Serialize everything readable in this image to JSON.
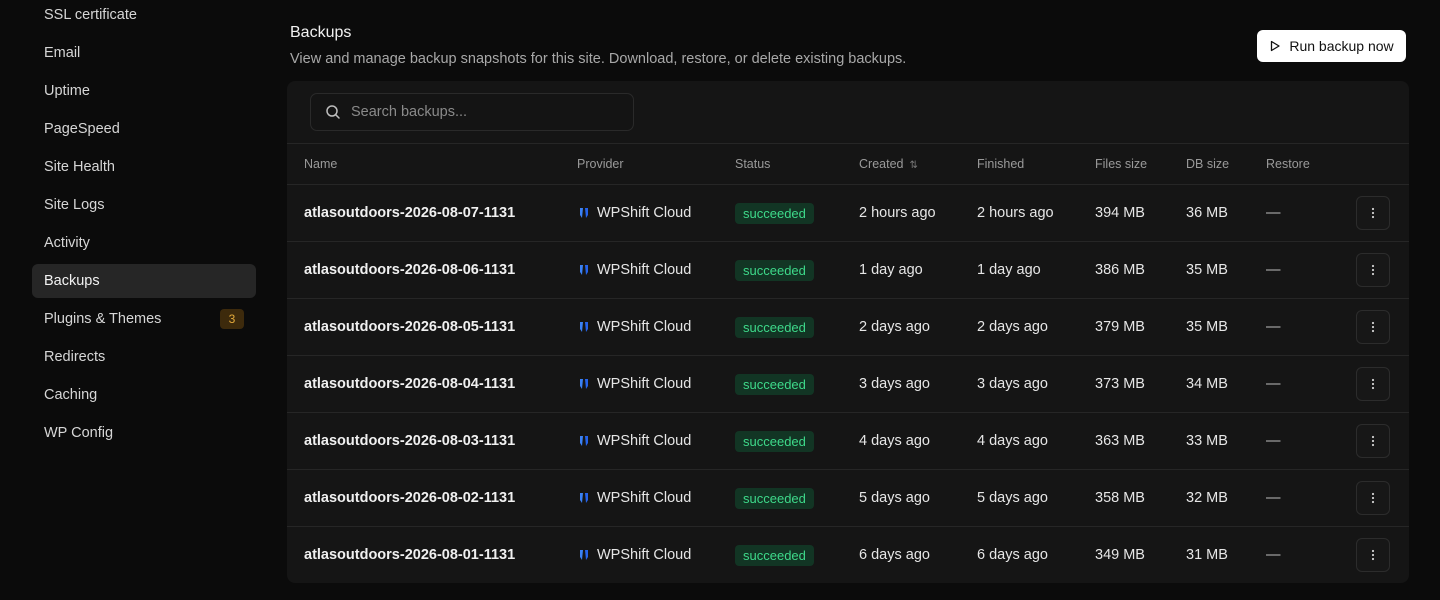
{
  "sidebar": {
    "items": [
      {
        "label": "SSL certificate"
      },
      {
        "label": "Email"
      },
      {
        "label": "Uptime"
      },
      {
        "label": "PageSpeed"
      },
      {
        "label": "Site Health"
      },
      {
        "label": "Site Logs"
      },
      {
        "label": "Activity"
      },
      {
        "label": "Backups",
        "active": true
      },
      {
        "label": "Plugins & Themes",
        "badge": "3"
      },
      {
        "label": "Redirects"
      },
      {
        "label": "Caching"
      },
      {
        "label": "WP Config"
      }
    ]
  },
  "header": {
    "title": "Backups",
    "description": "View and manage backup snapshots for this site. Download, restore, or delete existing backups.",
    "run_button": "Run backup now"
  },
  "search": {
    "placeholder": "Search backups..."
  },
  "table": {
    "columns": {
      "name": "Name",
      "provider": "Provider",
      "status": "Status",
      "created": "Created",
      "finished": "Finished",
      "files_size": "Files size",
      "db_size": "DB size",
      "restore": "Restore"
    },
    "rows": [
      {
        "name": "atlasoutdoors-2026-08-07-1131",
        "provider": "WPShift Cloud",
        "status": "succeeded",
        "created": "2 hours ago",
        "finished": "2 hours ago",
        "files_size": "394 MB",
        "db_size": "36 MB",
        "restore": "—"
      },
      {
        "name": "atlasoutdoors-2026-08-06-1131",
        "provider": "WPShift Cloud",
        "status": "succeeded",
        "created": "1 day ago",
        "finished": "1 day ago",
        "files_size": "386 MB",
        "db_size": "35 MB",
        "restore": "—"
      },
      {
        "name": "atlasoutdoors-2026-08-05-1131",
        "provider": "WPShift Cloud",
        "status": "succeeded",
        "created": "2 days ago",
        "finished": "2 days ago",
        "files_size": "379 MB",
        "db_size": "35 MB",
        "restore": "—"
      },
      {
        "name": "atlasoutdoors-2026-08-04-1131",
        "provider": "WPShift Cloud",
        "status": "succeeded",
        "created": "3 days ago",
        "finished": "3 days ago",
        "files_size": "373 MB",
        "db_size": "34 MB",
        "restore": "—"
      },
      {
        "name": "atlasoutdoors-2026-08-03-1131",
        "provider": "WPShift Cloud",
        "status": "succeeded",
        "created": "4 days ago",
        "finished": "4 days ago",
        "files_size": "363 MB",
        "db_size": "33 MB",
        "restore": "—"
      },
      {
        "name": "atlasoutdoors-2026-08-02-1131",
        "provider": "WPShift Cloud",
        "status": "succeeded",
        "created": "5 days ago",
        "finished": "5 days ago",
        "files_size": "358 MB",
        "db_size": "32 MB",
        "restore": "—"
      },
      {
        "name": "atlasoutdoors-2026-08-01-1131",
        "provider": "WPShift Cloud",
        "status": "succeeded",
        "created": "6 days ago",
        "finished": "6 days ago",
        "files_size": "349 MB",
        "db_size": "31 MB",
        "restore": "—"
      }
    ]
  },
  "colors": {
    "background": "#0b0b0b",
    "panel": "#151515",
    "status_success_bg": "#123524",
    "status_success_text": "#3ed98a",
    "badge_warning_bg": "#3d2a0c",
    "badge_warning_text": "#e2a93b",
    "provider_logo": "#3b82f6"
  },
  "icons": {
    "search": "search-icon",
    "run": "play-outline-icon",
    "provider": "wpshift-logo-icon",
    "sort": "sort-icon",
    "row_menu": "kebab-menu-icon"
  }
}
